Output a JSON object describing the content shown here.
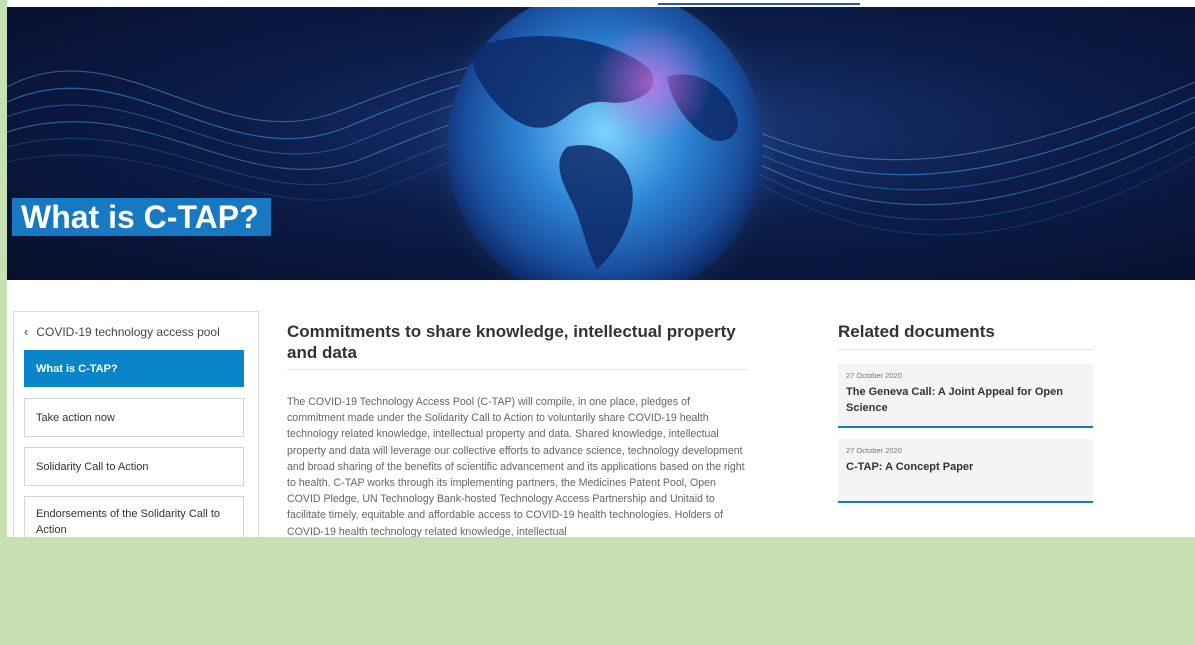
{
  "hero": {
    "title": "What is C-TAP?"
  },
  "sidebar": {
    "back_label": "COVID-19 technology access pool",
    "items": [
      {
        "label": "What is C-TAP?",
        "active": true
      },
      {
        "label": "Take action now"
      },
      {
        "label": "Solidarity Call to Action"
      },
      {
        "label": "Endorsements of the Solidarity Call to Action"
      }
    ]
  },
  "main": {
    "heading": "Commitments to share knowledge, intellectual property and data",
    "body": "The COVID-19 Technology Access Pool (C-TAP) will compile, in one place, pledges of commitment made under the Solidarity Call to Action to voluntarily share COVID-19 health technology related knowledge, intellectual property and data. Shared knowledge, intellectual property and data will leverage our collective efforts to advance science, technology development and broad sharing of the benefits of scientific advancement and its applications based on the right to health. C-TAP works through its implementing partners, the Medicines Patent Pool, Open COVID Pledge, UN Technology Bank-hosted Technology Access Partnership and Unitaid to facilitate timely, equitable and affordable access to COVID-19 health technologies. Holders of COVID-19 health technology related knowledge, intellectual"
  },
  "related": {
    "heading": "Related documents",
    "docs": [
      {
        "date": "27 October 2020",
        "title": "The Geneva Call: A Joint Appeal for Open Science"
      },
      {
        "date": "27 October 2020",
        "title": "C-TAP: A Concept Paper"
      }
    ]
  },
  "colors": {
    "accent": "#1679c2",
    "active_nav": "#0a86c8",
    "frame_green": "#c6dfb3",
    "hero_dark": "#0c1d4a"
  },
  "icons": {
    "back": "chevron-left-icon",
    "hero_art": "globe-illustration"
  }
}
